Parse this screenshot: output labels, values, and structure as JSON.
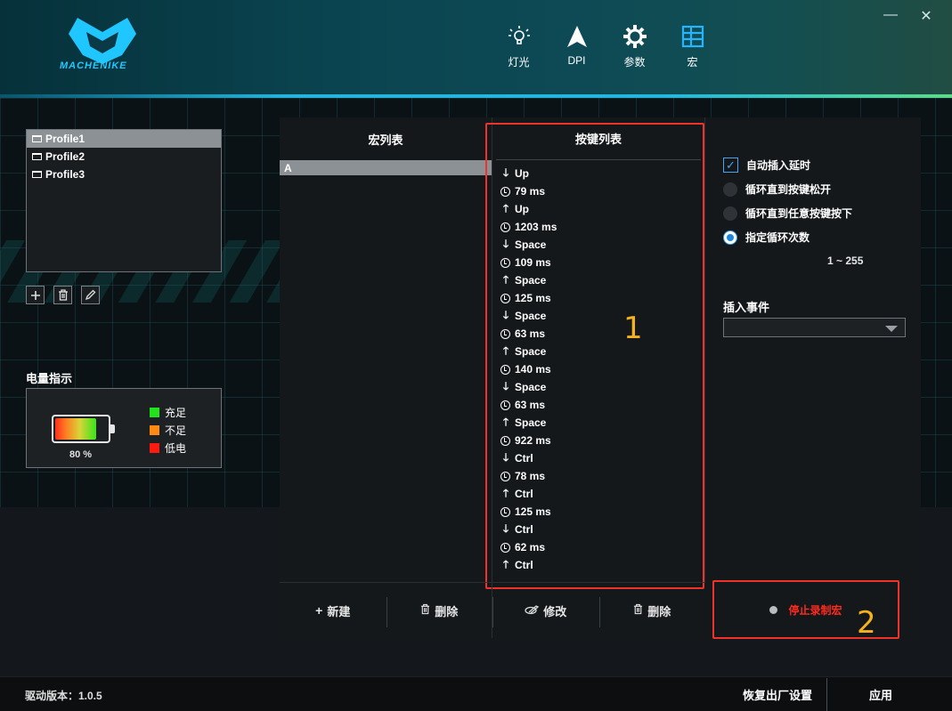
{
  "header": {
    "brand": "MACHENIKE",
    "nav": [
      {
        "label": "灯光",
        "icon": "lightbulb-icon"
      },
      {
        "label": "DPI",
        "icon": "arrow-pointer-icon"
      },
      {
        "label": "参数",
        "icon": "gear-icon"
      },
      {
        "label": "宏",
        "icon": "grid-table-icon"
      }
    ],
    "minimize_label": "—",
    "close_label": "✕"
  },
  "profiles": [
    "Profile1",
    "Profile2",
    "Profile3"
  ],
  "battery": {
    "title": "电量指示",
    "percent_label": "80 %",
    "level": 0.8,
    "legend": [
      {
        "label": "充足",
        "color": "#22e21e"
      },
      {
        "label": "不足",
        "color": "#ff8a12"
      },
      {
        "label": "低电",
        "color": "#ff1a10"
      }
    ]
  },
  "macro_list": {
    "header": "宏列表",
    "items": [
      "A"
    ]
  },
  "key_list": {
    "header": "按键列表",
    "events": [
      {
        "type": "down",
        "text": "Up"
      },
      {
        "type": "delay",
        "text": "79 ms"
      },
      {
        "type": "up",
        "text": "Up"
      },
      {
        "type": "delay",
        "text": "1203 ms"
      },
      {
        "type": "down",
        "text": "Space"
      },
      {
        "type": "delay",
        "text": "109 ms"
      },
      {
        "type": "up",
        "text": "Space"
      },
      {
        "type": "delay",
        "text": "125 ms"
      },
      {
        "type": "down",
        "text": "Space"
      },
      {
        "type": "delay",
        "text": "63 ms"
      },
      {
        "type": "up",
        "text": "Space"
      },
      {
        "type": "delay",
        "text": "140 ms"
      },
      {
        "type": "down",
        "text": "Space"
      },
      {
        "type": "delay",
        "text": "63 ms"
      },
      {
        "type": "up",
        "text": "Space"
      },
      {
        "type": "delay",
        "text": "922 ms"
      },
      {
        "type": "down",
        "text": "Ctrl"
      },
      {
        "type": "delay",
        "text": "78 ms"
      },
      {
        "type": "up",
        "text": "Ctrl"
      },
      {
        "type": "delay",
        "text": "125 ms"
      },
      {
        "type": "down",
        "text": "Ctrl"
      },
      {
        "type": "delay",
        "text": "62 ms"
      },
      {
        "type": "up",
        "text": "Ctrl"
      }
    ]
  },
  "annotations": {
    "one": "1",
    "two": "2"
  },
  "options": {
    "auto_delay": "自动插入延时",
    "loop_until_release": "循环直到按键松开",
    "loop_until_any": "循环直到任意按键按下",
    "loop_count": "指定循环次数",
    "range": "1 ~ 255",
    "insert_event_label": "插入事件"
  },
  "footer_buttons": {
    "new": "新建",
    "delete_macro": "删除",
    "modify": "修改",
    "delete_key": "删除"
  },
  "record": {
    "label": "停止录制宏"
  },
  "status": {
    "version": "驱动版本：1.0.5",
    "reset": "恢复出厂设置",
    "apply": "应用"
  }
}
